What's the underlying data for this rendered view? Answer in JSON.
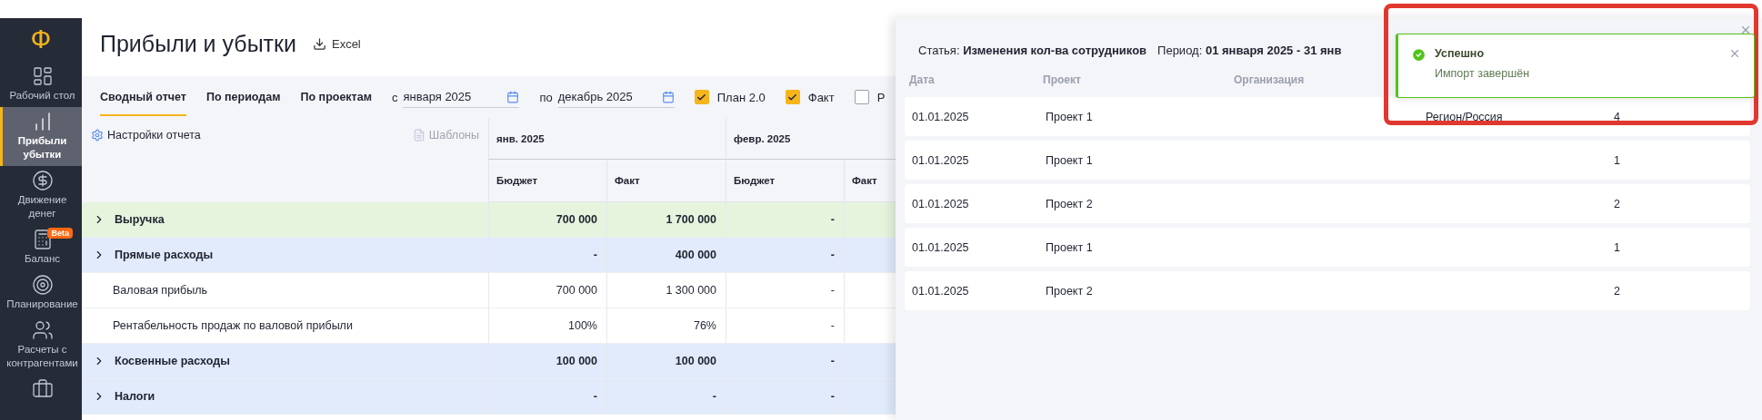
{
  "sidebar": {
    "logo": "Ф",
    "items": [
      {
        "label": "Рабочий стол",
        "selected": false
      },
      {
        "label": "Прибыли убытки",
        "selected": true
      },
      {
        "label": "Движение денег",
        "selected": false
      },
      {
        "label": "Баланс",
        "selected": false,
        "badge": "Beta"
      },
      {
        "label": "Планирование",
        "selected": false
      },
      {
        "label": "Расчеты с контрагентами",
        "selected": false
      },
      {
        "selected": false
      }
    ]
  },
  "page": {
    "title": "Прибыли и убытки",
    "export": "Excel"
  },
  "tabs": [
    {
      "label": "Сводный отчет",
      "selected": true
    },
    {
      "label": "По периодам",
      "selected": false
    },
    {
      "label": "По проектам",
      "selected": false
    }
  ],
  "date_from": {
    "prefix": "с",
    "value": "января 2025"
  },
  "date_to": {
    "prefix": "по",
    "value": "декабрь 2025"
  },
  "filters": [
    {
      "label": "План 2.0",
      "checked": true
    },
    {
      "label": "Факт",
      "checked": true
    },
    {
      "label": "Р",
      "checked": false
    }
  ],
  "table": {
    "settings": "Настройки отчета",
    "templates": "Шаблоны",
    "months": [
      "янв. 2025",
      "февр. 2025"
    ],
    "columns": [
      "Бюджет",
      "Факт",
      "Бюджет",
      "Факт"
    ],
    "rows": [
      {
        "kind": "income",
        "name": "Выручка",
        "values": [
          "700 000",
          "1 700 000",
          "-"
        ]
      },
      {
        "kind": "expense",
        "name": "Прямые расходы",
        "values": [
          "-",
          "400 000",
          "-"
        ]
      },
      {
        "kind": "metric",
        "name": "Валовая прибыль",
        "values": [
          "700 000",
          "1 300 000",
          "-"
        ]
      },
      {
        "kind": "metric",
        "name": "Рентабельность продаж по валовой прибыли",
        "values": [
          "100%",
          "76%",
          "-"
        ]
      },
      {
        "kind": "expense",
        "name": "Косвенные расходы",
        "values": [
          "100 000",
          "100 000",
          "-"
        ]
      },
      {
        "kind": "expense",
        "name": "Налоги",
        "values": [
          "-",
          "-",
          "-"
        ]
      }
    ]
  },
  "detail_panel": {
    "article_label": "Статья:",
    "article": "Изменения кол-ва сотрудников",
    "period_label": "Период:",
    "period": "01 января 2025 - 31 янв",
    "columns": [
      "Дата",
      "Проект",
      "Организация"
    ],
    "rows": [
      {
        "date": "01.01.2025",
        "project": "Проект 1",
        "region": "Регион/Россия",
        "count": "4"
      },
      {
        "date": "01.01.2025",
        "project": "Проект 1",
        "count": "1"
      },
      {
        "date": "01.01.2025",
        "project": "Проект 2",
        "count": "2"
      },
      {
        "date": "01.01.2025",
        "project": "Проект 1",
        "count": "1"
      },
      {
        "date": "01.01.2025",
        "project": "Проект 2",
        "count": "2"
      }
    ]
  },
  "toast": {
    "title": "Успешно",
    "message": "Импорт завершён"
  }
}
